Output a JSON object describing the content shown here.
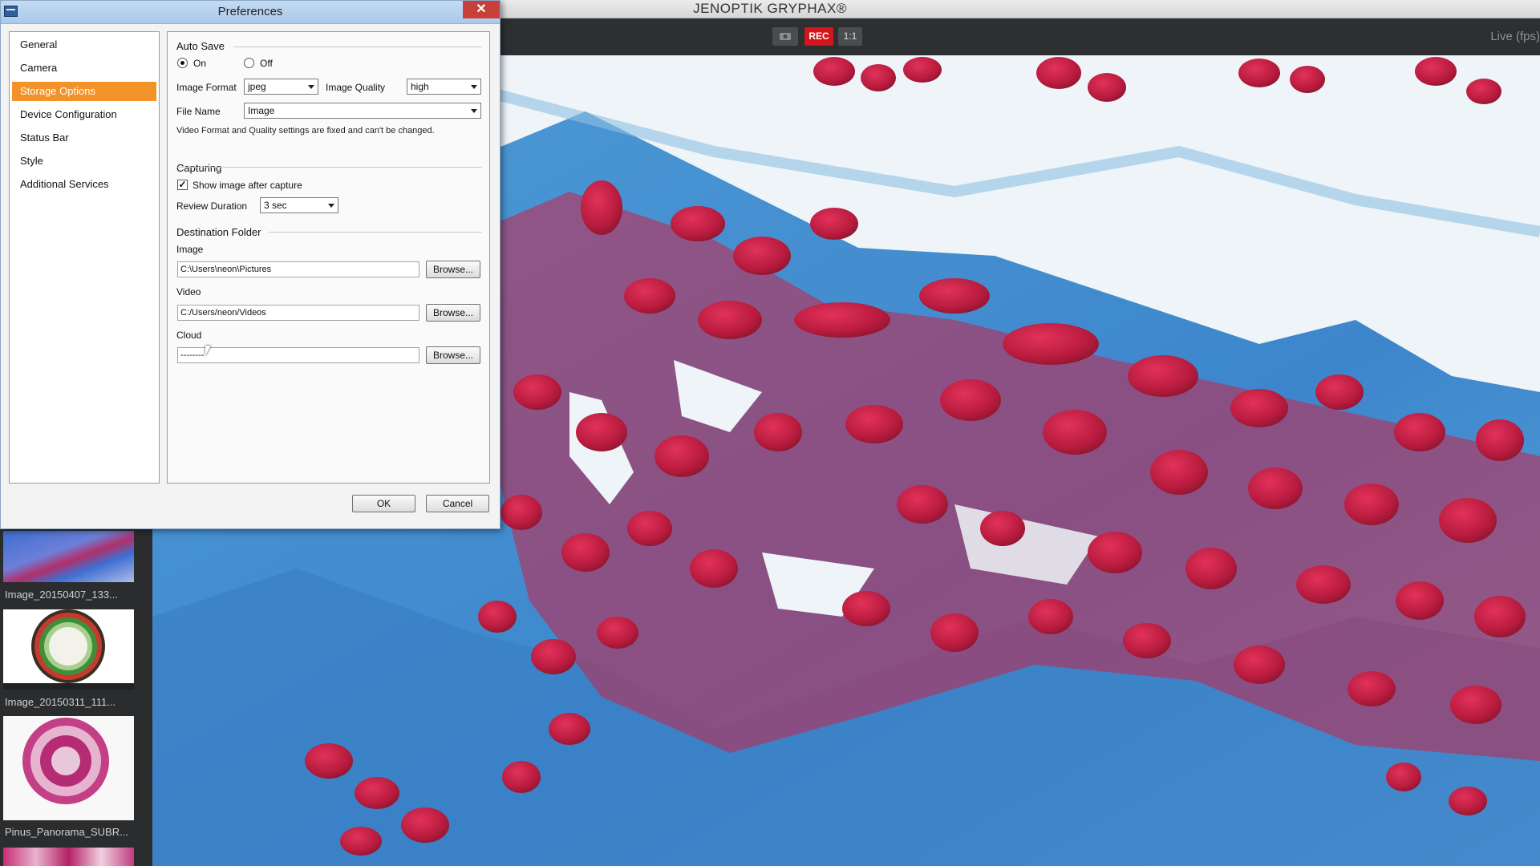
{
  "app": {
    "title": "JENOPTIK GRYPHAX®",
    "toolbar": {
      "snapshot_icon": "camera-icon",
      "rec_label": "REC",
      "ratio_label": "1:1",
      "live_fps_label": "Live (fps)"
    },
    "gallery": {
      "items": [
        {
          "caption": "Image_20150407_133..."
        },
        {
          "caption": "Image_20150311_111..."
        },
        {
          "caption": "Pinus_Panorama_SUBR..."
        }
      ]
    }
  },
  "preferences": {
    "title": "Preferences",
    "close_label": "✕",
    "nav": {
      "items": [
        {
          "label": "General"
        },
        {
          "label": "Camera"
        },
        {
          "label": "Storage Options"
        },
        {
          "label": "Device Configuration"
        },
        {
          "label": "Status Bar"
        },
        {
          "label": "Style"
        },
        {
          "label": "Additional Services"
        }
      ],
      "selected": "Storage Options"
    },
    "auto_save": {
      "title": "Auto Save",
      "on_label": "On",
      "off_label": "Off",
      "selected": "On",
      "image_format_label": "Image Format",
      "image_format_value": "jpeg",
      "image_quality_label": "Image Quality",
      "image_quality_value": "high",
      "file_name_label": "File Name",
      "file_name_value": "Image",
      "note": "Video Format and Quality settings are fixed and can't be changed."
    },
    "capturing": {
      "title": "Capturing",
      "show_image_label": "Show image after capture",
      "show_image_checked": true,
      "review_duration_label": "Review Duration",
      "review_duration_value": "3 sec"
    },
    "destination": {
      "title": "Destination Folder",
      "image_label": "Image",
      "image_path": "C:\\Users\\neon\\Pictures",
      "video_label": "Video",
      "video_path": "C:/Users/neon/Videos",
      "cloud_label": "Cloud",
      "cloud_path": "--------",
      "browse_label": "Browse..."
    },
    "ok_label": "OK",
    "cancel_label": "Cancel"
  }
}
